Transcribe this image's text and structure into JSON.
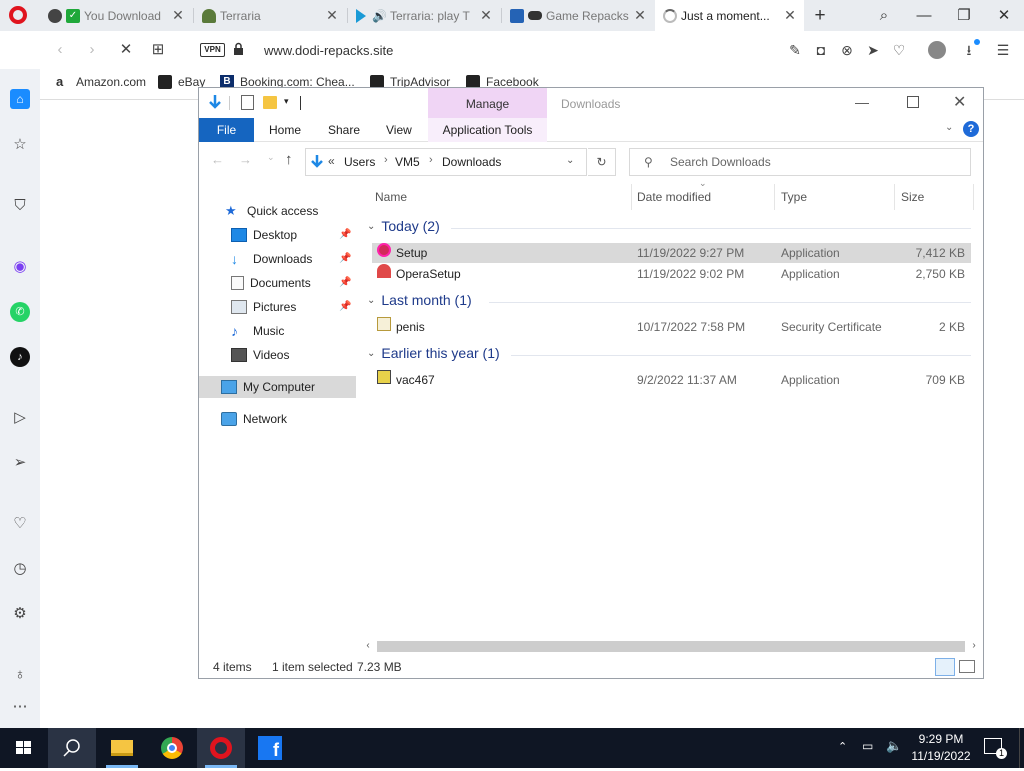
{
  "browser": {
    "tabs": [
      {
        "label": "You Download"
      },
      {
        "label": "Terraria"
      },
      {
        "label": "Terraria: play T"
      },
      {
        "label": "Game Repacks"
      },
      {
        "label": "Just a moment..."
      }
    ],
    "url": "www.dodi-repacks.site",
    "vpn_label": "VPN",
    "bookmarks": [
      "Amazon.com",
      "eBay",
      "Booking.com: Chea...",
      "TripAdvisor",
      "Facebook"
    ]
  },
  "explorer": {
    "title": "Downloads",
    "manage_label": "Manage",
    "ribbon": {
      "file": "File",
      "home": "Home",
      "share": "Share",
      "view": "View",
      "app_tools": "Application Tools"
    },
    "breadcrumb": {
      "overflow": "«",
      "segments": [
        "Users",
        "VM5",
        "Downloads"
      ]
    },
    "search_placeholder": "Search Downloads",
    "nav": {
      "quick_access": "Quick access",
      "items": [
        "Desktop",
        "Downloads",
        "Documents",
        "Pictures",
        "Music",
        "Videos"
      ],
      "my_computer": "My Computer",
      "network": "Network"
    },
    "columns": {
      "name": "Name",
      "date": "Date modified",
      "type": "Type",
      "size": "Size"
    },
    "groups": [
      {
        "label": "Today (2)",
        "files": [
          {
            "name": "Setup",
            "date": "11/19/2022 9:27 PM",
            "type": "Application",
            "size": "7,412 KB",
            "selected": true
          },
          {
            "name": "OperaSetup",
            "date": "11/19/2022 9:02 PM",
            "type": "Application",
            "size": "2,750 KB"
          }
        ]
      },
      {
        "label": "Last month (1)",
        "files": [
          {
            "name": "penis",
            "date": "10/17/2022 7:58 PM",
            "type": "Security Certificate",
            "size": "2 KB"
          }
        ]
      },
      {
        "label": "Earlier this year (1)",
        "files": [
          {
            "name": "vac467",
            "date": "9/2/2022 11:37 AM",
            "type": "Application",
            "size": "709 KB"
          }
        ]
      }
    ],
    "status": {
      "count": "4 items",
      "selected": "1 item selected",
      "size": "7.23 MB"
    }
  },
  "taskbar": {
    "time": "9:29 PM",
    "date": "11/19/2022",
    "notification_count": "1"
  },
  "colors": {
    "accent": "#1565c0",
    "manage_tab": "#f0d5f5",
    "opera_red": "#e0141e",
    "taskbar": "#0f1624"
  }
}
